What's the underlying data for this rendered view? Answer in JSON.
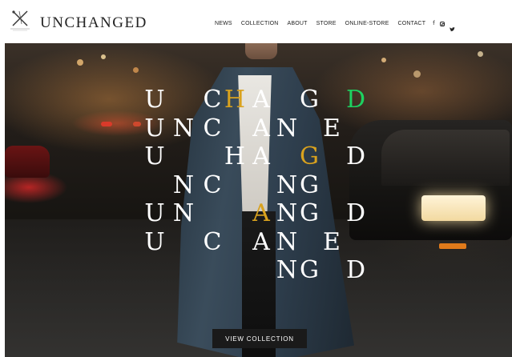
{
  "brand": {
    "name": "UNCHANGED",
    "logo_icon": "crossed-needles-icon"
  },
  "nav": {
    "items": [
      "NEWS",
      "COLLECTION",
      "ABOUT",
      "STORE",
      "ONLINE-STORE",
      "CONTACT"
    ],
    "social": [
      {
        "name": "facebook-icon",
        "glyph": "f"
      },
      {
        "name": "instagram-icon",
        "glyph": ""
      },
      {
        "name": "twitter-icon",
        "glyph": ""
      }
    ]
  },
  "hero": {
    "type_grid": {
      "rows": [
        [
          {
            "char": "U",
            "color": "white"
          },
          {
            "char": "",
            "color": "white"
          },
          {
            "char": "C",
            "color": "white"
          },
          {
            "char": "H",
            "color": "accent"
          },
          {
            "char": "A",
            "color": "white"
          },
          {
            "char": "",
            "color": "white"
          },
          {
            "char": "G",
            "color": "white"
          },
          {
            "char": "",
            "color": "white"
          },
          {
            "char": "D",
            "color": "green"
          }
        ],
        [
          {
            "char": "U",
            "color": "white"
          },
          {
            "char": "N",
            "color": "white"
          },
          {
            "char": "C",
            "color": "white"
          },
          {
            "char": "",
            "color": "white"
          },
          {
            "char": "A",
            "color": "white"
          },
          {
            "char": "N",
            "color": "white"
          },
          {
            "char": "",
            "color": "white"
          },
          {
            "char": "E",
            "color": "white"
          },
          {
            "char": "",
            "color": "white"
          }
        ],
        [
          {
            "char": "U",
            "color": "white"
          },
          {
            "char": "",
            "color": "white"
          },
          {
            "char": "",
            "color": "white"
          },
          {
            "char": "H",
            "color": "white"
          },
          {
            "char": "A",
            "color": "white"
          },
          {
            "char": "",
            "color": "white"
          },
          {
            "char": "G",
            "color": "accent"
          },
          {
            "char": "",
            "color": "white"
          },
          {
            "char": "D",
            "color": "white"
          }
        ],
        [
          {
            "char": "",
            "color": "white"
          },
          {
            "char": "N",
            "color": "white"
          },
          {
            "char": "C",
            "color": "white"
          },
          {
            "char": "",
            "color": "white"
          },
          {
            "char": "",
            "color": "white"
          },
          {
            "char": "N",
            "color": "white"
          },
          {
            "char": "G",
            "color": "white"
          },
          {
            "char": "",
            "color": "white"
          },
          {
            "char": "",
            "color": "white"
          }
        ],
        [
          {
            "char": "U",
            "color": "white"
          },
          {
            "char": "N",
            "color": "white"
          },
          {
            "char": "",
            "color": "white"
          },
          {
            "char": "",
            "color": "white"
          },
          {
            "char": "A",
            "color": "accent"
          },
          {
            "char": "N",
            "color": "white"
          },
          {
            "char": "G",
            "color": "white"
          },
          {
            "char": "",
            "color": "white"
          },
          {
            "char": "D",
            "color": "white"
          }
        ],
        [
          {
            "char": "U",
            "color": "white"
          },
          {
            "char": "",
            "color": "white"
          },
          {
            "char": "C",
            "color": "white"
          },
          {
            "char": "",
            "color": "white"
          },
          {
            "char": "A",
            "color": "white"
          },
          {
            "char": "N",
            "color": "white"
          },
          {
            "char": "",
            "color": "white"
          },
          {
            "char": "E",
            "color": "white"
          },
          {
            "char": "",
            "color": "white"
          }
        ],
        [
          {
            "char": "",
            "color": "white"
          },
          {
            "char": "",
            "color": "white"
          },
          {
            "char": "",
            "color": "white"
          },
          {
            "char": "",
            "color": "white"
          },
          {
            "char": "",
            "color": "white"
          },
          {
            "char": "N",
            "color": "white"
          },
          {
            "char": "G",
            "color": "white"
          },
          {
            "char": "",
            "color": "white"
          },
          {
            "char": "D",
            "color": "white"
          }
        ]
      ]
    },
    "cta_label": "VIEW COLLECTION"
  },
  "colors": {
    "accent": "#d9a21e",
    "green": "#1dd160",
    "button_bg": "#1a1a1a"
  }
}
